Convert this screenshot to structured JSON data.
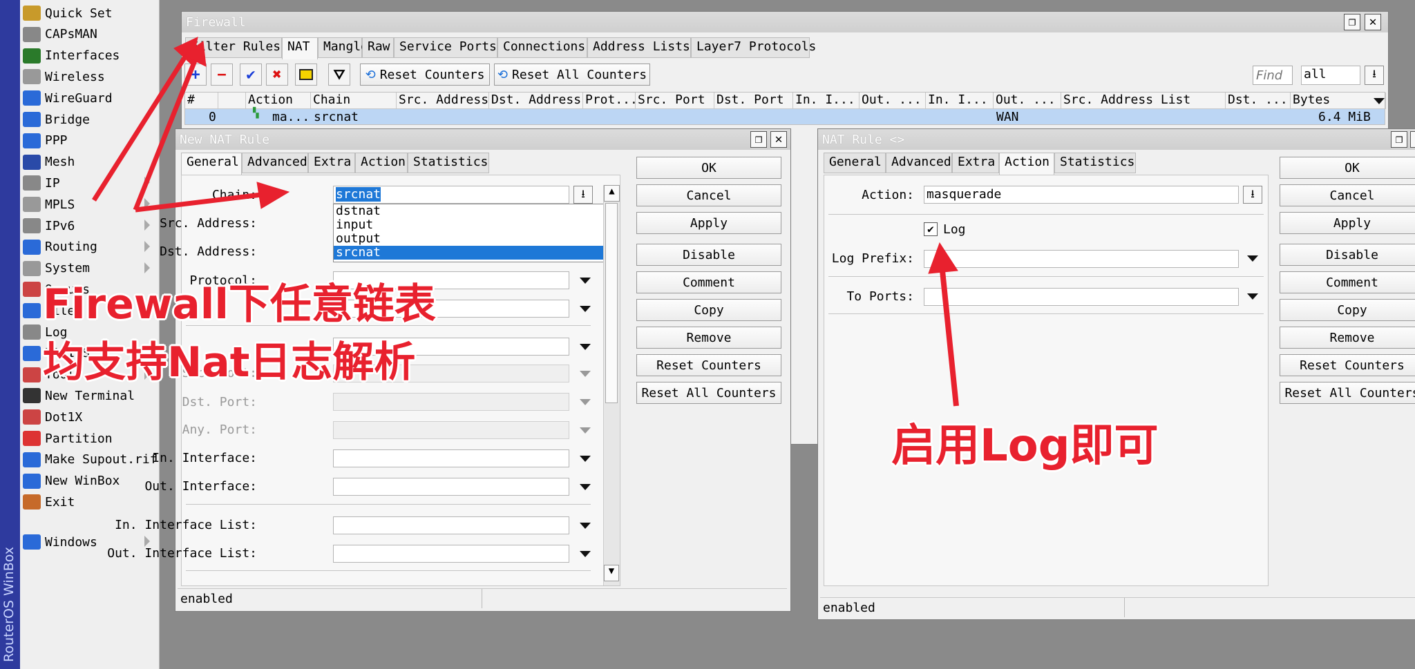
{
  "brand_vertical": "RouterOS WinBox",
  "sidebar": {
    "items": [
      {
        "label": "Quick Set",
        "icon": "wand-icon",
        "arrow": false
      },
      {
        "label": "CAPsMAN",
        "icon": "capsman-icon",
        "arrow": false
      },
      {
        "label": "Interfaces",
        "icon": "interfaces-icon",
        "arrow": false
      },
      {
        "label": "Wireless",
        "icon": "wireless-icon",
        "arrow": false
      },
      {
        "label": "WireGuard",
        "icon": "wireguard-icon",
        "arrow": false
      },
      {
        "label": "Bridge",
        "icon": "bridge-icon",
        "arrow": false
      },
      {
        "label": "PPP",
        "icon": "ppp-icon",
        "arrow": false
      },
      {
        "label": "Mesh",
        "icon": "mesh-icon",
        "arrow": false
      },
      {
        "label": "IP",
        "icon": "ip-icon",
        "arrow": true
      },
      {
        "label": "MPLS",
        "icon": "mpls-icon",
        "arrow": true
      },
      {
        "label": "IPv6",
        "icon": "ipv6-icon",
        "arrow": true
      },
      {
        "label": "Routing",
        "icon": "routing-icon",
        "arrow": true
      },
      {
        "label": "System",
        "icon": "system-icon",
        "arrow": true
      },
      {
        "label": "Queues",
        "icon": "queues-icon",
        "arrow": false
      },
      {
        "label": "Files",
        "icon": "files-icon",
        "arrow": false
      },
      {
        "label": "Log",
        "icon": "log-icon",
        "arrow": false
      },
      {
        "label": "RADIUS",
        "icon": "radius-icon",
        "arrow": false
      },
      {
        "label": "Tools",
        "icon": "tools-icon",
        "arrow": true
      },
      {
        "label": "New Terminal",
        "icon": "terminal-icon",
        "arrow": false
      },
      {
        "label": "Dot1X",
        "icon": "dot1x-icon",
        "arrow": false
      },
      {
        "label": "Partition",
        "icon": "partition-icon",
        "arrow": false
      },
      {
        "label": "Make Supout.rif",
        "icon": "supout-icon",
        "arrow": false
      },
      {
        "label": "New WinBox",
        "icon": "winbox-icon",
        "arrow": false
      },
      {
        "label": "Exit",
        "icon": "exit-icon",
        "arrow": false
      },
      {
        "label": "Windows",
        "icon": "windows-icon",
        "arrow": true
      }
    ]
  },
  "firewall": {
    "title": "Firewall",
    "tabs": [
      "Filter Rules",
      "NAT",
      "Mangle",
      "Raw",
      "Service Ports",
      "Connections",
      "Address Lists",
      "Layer7 Protocols"
    ],
    "active_tab": "NAT",
    "toolbar": {
      "reset_counters": "Reset Counters",
      "reset_all_counters": "Reset All Counters",
      "find_placeholder": "Find",
      "filter_value": "all"
    },
    "columns": [
      "#",
      "",
      "Action",
      "Chain",
      "Src. Address",
      "Dst. Address",
      "Prot...",
      "Src. Port",
      "Dst. Port",
      "In. I...",
      "Out. ...",
      "In. I...",
      "Out. ...",
      "Src. Address List",
      "Dst. ...",
      "Bytes"
    ],
    "row": {
      "num": "0",
      "action": "ma...",
      "chain": "srcnat",
      "out_interface": "WAN",
      "bytes": "6.4 MiB"
    }
  },
  "new_nat_rule": {
    "title": "New NAT Rule",
    "tabs": [
      "General",
      "Advanced",
      "Extra",
      "Action",
      "Statistics"
    ],
    "active_tab": "General",
    "fields": {
      "chain_label": "Chain:",
      "chain_value": "srcnat",
      "src_address_label": "Src. Address:",
      "dst_address_label": "Dst. Address:",
      "protocol_label": "Protocol:",
      "src_port_label": "Src. Port:",
      "dst_port_label": "Dst. Port:",
      "any_port_label": "Any. Port:",
      "in_interface_label": "In. Interface:",
      "out_interface_label": "Out. Interface:",
      "in_interface_list_label": "In. Interface List:",
      "out_interface_list_label": "Out. Interface List:"
    },
    "chain_options": [
      "dstnat",
      "input",
      "output",
      "srcnat"
    ],
    "chain_selected": "srcnat",
    "buttons": [
      "OK",
      "Cancel",
      "Apply",
      "Disable",
      "Comment",
      "Copy",
      "Remove",
      "Reset Counters",
      "Reset All Counters"
    ],
    "status": "enabled"
  },
  "nat_rule": {
    "title": "NAT Rule <>",
    "tabs": [
      "General",
      "Advanced",
      "Extra",
      "Action",
      "Statistics"
    ],
    "active_tab": "Action",
    "action_label": "Action:",
    "action_value": "masquerade",
    "log_label": "Log",
    "log_checked": true,
    "log_prefix_label": "Log Prefix:",
    "to_ports_label": "To Ports:",
    "buttons": [
      "OK",
      "Cancel",
      "Apply",
      "Disable",
      "Comment",
      "Copy",
      "Remove",
      "Reset Counters",
      "Reset All Counters"
    ],
    "status": "enabled"
  },
  "annotations": {
    "left_line1": "Firewall下任意链表",
    "left_line2": "均支持Nat日志解析",
    "right": "启用Log即可",
    "color": "#e8212e"
  }
}
